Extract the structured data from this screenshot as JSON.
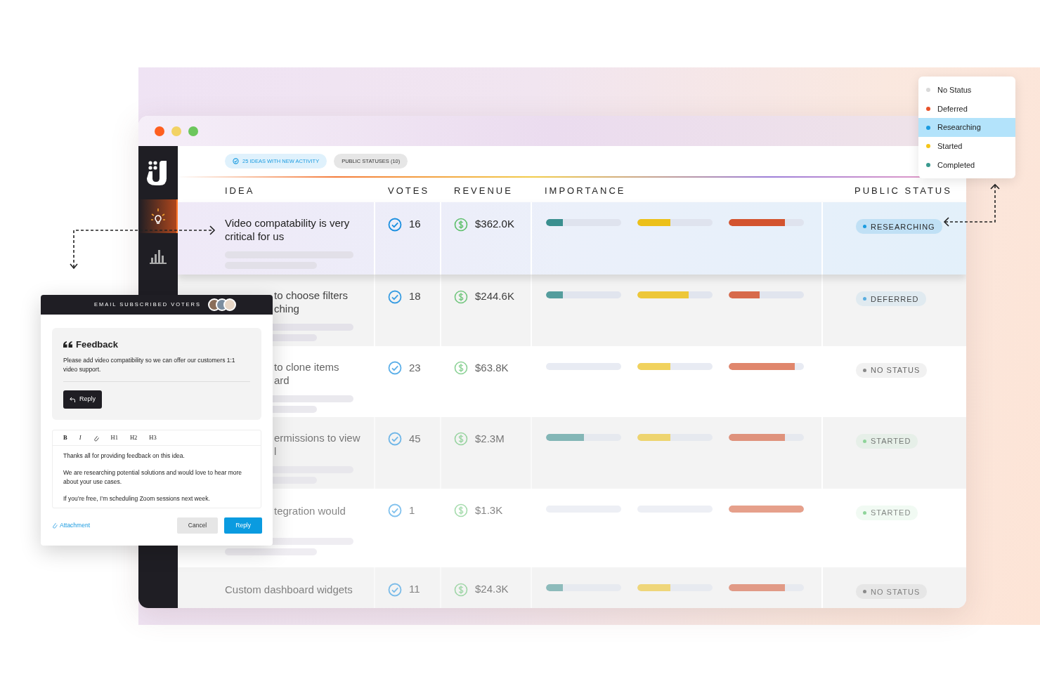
{
  "sidebar": {
    "items": [
      {
        "kind": "ideas",
        "selected": true
      },
      {
        "kind": "analytics",
        "selected": false
      }
    ]
  },
  "filters": [
    {
      "label": "25 IDEAS WITH NEW ACTIVITY",
      "kind": "activity"
    },
    {
      "label": "PUBLIC STATUSES (10)",
      "kind": "plain"
    }
  ],
  "table": {
    "columns": [
      "IDEA",
      "VOTES",
      "REVENUE",
      "IMPORTANCE",
      "PUBLIC STATUS"
    ],
    "rows": [
      {
        "idea": [
          "Video compatability is very",
          "critical for us"
        ],
        "kind": "full",
        "selected": true,
        "votes": "16",
        "revenue": "$362.0K",
        "importance": [
          {
            "level": 0.22
          },
          {
            "level": 0.44
          },
          {
            "level": 0.75
          }
        ],
        "status": {
          "label": "RESEARCHING",
          "color": "#1a9be0"
        }
      },
      {
        "idea": [
          "to choose filters",
          "ching"
        ],
        "kind": "partly_hidden",
        "selected": false,
        "votes": "18",
        "revenue": "$244.6K",
        "importance": [
          {
            "level": 0.22
          },
          {
            "level": 0.68
          },
          {
            "level": 0.41
          }
        ],
        "status": {
          "label": "DEFERRED",
          "color": "#5aaee0"
        }
      },
      {
        "idea": [
          "to clone items",
          "ard"
        ],
        "kind": "partly_hidden",
        "selected": false,
        "votes": "23",
        "revenue": "$63.8K",
        "importance": [
          {
            "level": 0
          },
          {
            "level": 0.44
          },
          {
            "level": 0.88
          }
        ],
        "status": {
          "label": "NO STATUS",
          "color": "#8a8a8a"
        }
      },
      {
        "idea": [
          "ermissions to view",
          "l"
        ],
        "kind": "partly_hidden",
        "selected": false,
        "votes": "45",
        "revenue": "$2.3M",
        "importance": [
          {
            "level": 0.5
          },
          {
            "level": 0.44
          },
          {
            "level": 0.75
          }
        ],
        "status": {
          "label": "STARTED",
          "color": "#8fd49a"
        }
      },
      {
        "idea": [
          "tegration would"
        ],
        "kind": "partly_hidden",
        "selected": false,
        "votes": "1",
        "revenue": "$1.3K",
        "importance": [
          {
            "level": 0
          },
          {
            "level": 0
          },
          {
            "level": 1
          }
        ],
        "status": {
          "label": "STARTED",
          "color": "#8fd49a"
        }
      },
      {
        "idea": [
          "Custom dashboard widgets"
        ],
        "kind": "full",
        "selected": false,
        "votes": "11",
        "revenue": "$24.3K",
        "importance": [
          {
            "level": 0.22
          },
          {
            "level": 0.44
          },
          {
            "level": 0.75
          }
        ],
        "status": {
          "label": "NO STATUS",
          "color": "#8a8a8a"
        }
      }
    ]
  },
  "status_menu": {
    "items": [
      {
        "label": "No Status",
        "color": "#d9d9d9",
        "selected": false
      },
      {
        "label": "Deferred",
        "color": "#e8522a",
        "selected": false
      },
      {
        "label": "Researching",
        "color": "#1a9be0",
        "selected": true
      },
      {
        "label": "Started",
        "color": "#f5c518",
        "selected": false
      },
      {
        "label": "Completed",
        "color": "#3a9a8f",
        "selected": false
      }
    ]
  },
  "email_panel": {
    "title": "EMAIL SUBSCRIBED VOTERS",
    "feedback": {
      "title": "Feedback",
      "text": "Please add video compatibility so we can offer our customers 1:1 video support.",
      "button": "Reply"
    },
    "toolbar": [
      {
        "label": "B",
        "kind": "bold"
      },
      {
        "label": "I",
        "kind": "italic"
      },
      {
        "kind": "link"
      },
      {
        "label": "H1",
        "kind": "heading"
      },
      {
        "label": "H2",
        "kind": "heading"
      },
      {
        "label": "H3",
        "kind": "heading"
      }
    ],
    "message": [
      "Thanks all for providing feedback on this idea.",
      "We are researching potential solutions and would love to hear more about your use cases.",
      "If you’re free, I’m scheduling Zoom sessions next week."
    ],
    "attachment": "Attachment",
    "buttons": [
      {
        "label": "Cancel",
        "kind": "secondary"
      },
      {
        "label": "Reply",
        "kind": "primary"
      }
    ]
  }
}
